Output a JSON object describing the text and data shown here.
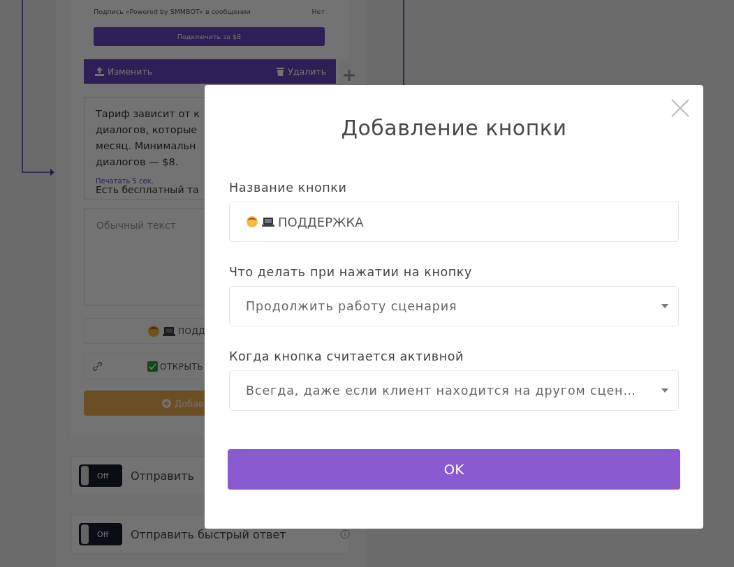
{
  "background": {
    "signature_label": "Подпись «Powered by SMMBOT» в сообщении",
    "signature_value": "Нет",
    "connect_button": "Подключить за $8",
    "edit_button": "Изменить",
    "delete_button": "Удалить",
    "message_lines": [
      "Тариф зависит от к",
      "диалогов, которые",
      "месяц. Минимальн",
      "диалогов — $8."
    ],
    "typing_label": "Печатать 5 сек.",
    "message_next_line": "Есть бесплатный та",
    "text_placeholder": "Обычный текст",
    "buttons": [
      {
        "kind": "reply",
        "label": "ПОДД"
      },
      {
        "kind": "link",
        "label": "ОТКРЫТЬ"
      }
    ],
    "add_button": "Добав",
    "toggles": [
      {
        "label": "Отправить",
        "on": false,
        "state_text": "Off"
      },
      {
        "label": "Отправить быстрый ответ",
        "on": false,
        "state_text": "Off"
      }
    ]
  },
  "modal": {
    "title": "Добавление кнопки",
    "fields": [
      {
        "kind": "text",
        "label": "Название кнопки",
        "value": "ПОДДЕРЖКА"
      },
      {
        "kind": "select",
        "label": "Что делать при нажатии на кнопку",
        "value": "Продолжить работу сценария"
      },
      {
        "kind": "select",
        "label": "Когда кнопка считается активной",
        "value": "Всегда, даже если клиент находится на другом сцен…"
      }
    ],
    "ok_button": "OK"
  }
}
